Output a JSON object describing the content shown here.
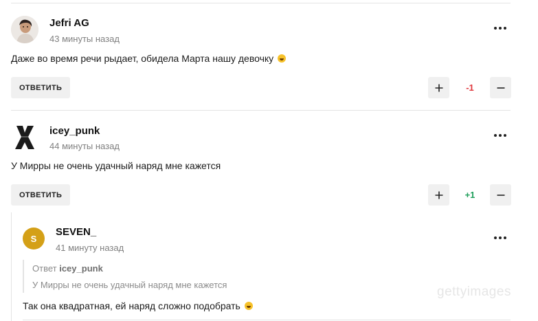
{
  "comments": [
    {
      "author": "Jefri AG",
      "time": "43 минуты назад",
      "text": "Даже во время речи рыдает, обидела Марта нашу девочку",
      "reply_label": "ОТВЕТИТЬ",
      "score": "-1",
      "score_color": "#e0393e"
    },
    {
      "author": "icey_punk",
      "time": "44 минуты назад",
      "text": "У Мирры не очень удачный наряд мне кажется",
      "reply_label": "ОТВЕТИТЬ",
      "score": "+1",
      "score_color": "#1e9e5a"
    },
    {
      "author": "SEVEN_",
      "avatar_letter": "S",
      "avatar_color": "#d4a017",
      "time": "41 минуту назад",
      "reply_to_label": "Ответ",
      "reply_to_author": "icey_punk",
      "quote_text": "У Мирры не очень удачный наряд мне кажется",
      "text": "Так она квадратная, ей наряд сложно подобрать"
    }
  ],
  "watermark": "gettyimages",
  "icons": {
    "more": "more-dots-icon",
    "plus": "plus-icon",
    "minus": "minus-icon",
    "emoji": "grinning-emoji-icon"
  }
}
